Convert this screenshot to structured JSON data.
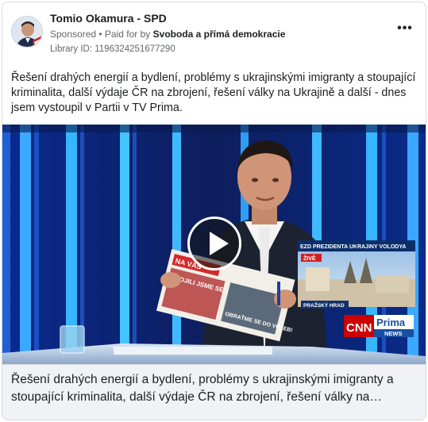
{
  "post": {
    "page_name": "Tomio Okamura - SPD",
    "sponsored_label": "Sponsored",
    "paid_for_prefix": "• Paid for by",
    "paid_for_by": "Svoboda a přímá demokracie",
    "library_id": "Library ID: 1196324251677290",
    "more_label": "•••",
    "body_text": "Řešení drahých energií a bydlení, problémy s ukrajinskými imigranty a stoupající kriminalita, další výdaje ČR na zbrojení, řešení války na Ukrajině a další - dnes jsem vystoupil v Partii v TV Prima."
  },
  "video": {
    "ticker_text": "EZD PREZIDENTA UKRAJINY VOLODYA",
    "live_label": "ŽIVĚ",
    "location_label": "PRAŽSKÝ HRAD",
    "cnn_label": "CNN",
    "prima_label": "Prima",
    "news_label": "NEWS",
    "newspaper_masthead": "NA VÁS",
    "newspaper_headline": "SPOJILI JSME SE",
    "newspaper_subhead": "OBRAŤME SE DO VOLEB!"
  },
  "footer": {
    "caption": "Řešení drahých energií a bydlení, problémy s ukrajinskými imigranty a stoupající kriminalita, další výdaje ČR na zbrojení, řešení války na…"
  },
  "colors": {
    "studio_blue": "#0a1f6e",
    "cnn_red": "#cc0000",
    "prima_blue": "#1a4fa0"
  }
}
